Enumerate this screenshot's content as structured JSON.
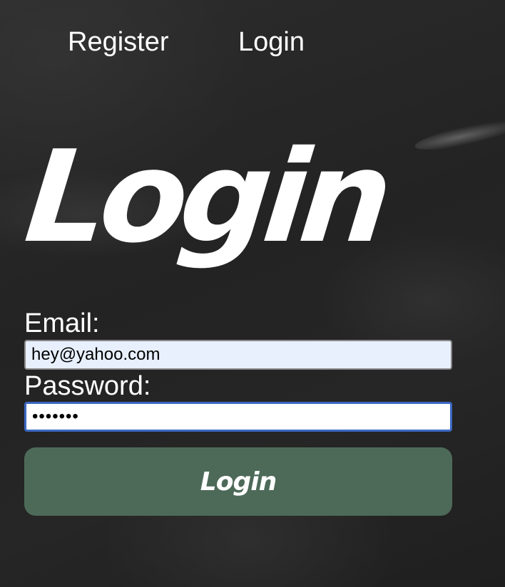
{
  "nav": {
    "register_label": "Register",
    "login_label": "Login"
  },
  "heading": {
    "title": "Login"
  },
  "form": {
    "email_label": "Email:",
    "email_value": "hey@yahoo.com",
    "password_label": "Password:",
    "password_value": "•••••••",
    "submit_label": "Login"
  },
  "colors": {
    "background": "#262626",
    "text": "#ffffff",
    "button_background": "#4d6a58",
    "email_input_background": "#e8f0fe",
    "focus_border": "#3b68c2"
  }
}
